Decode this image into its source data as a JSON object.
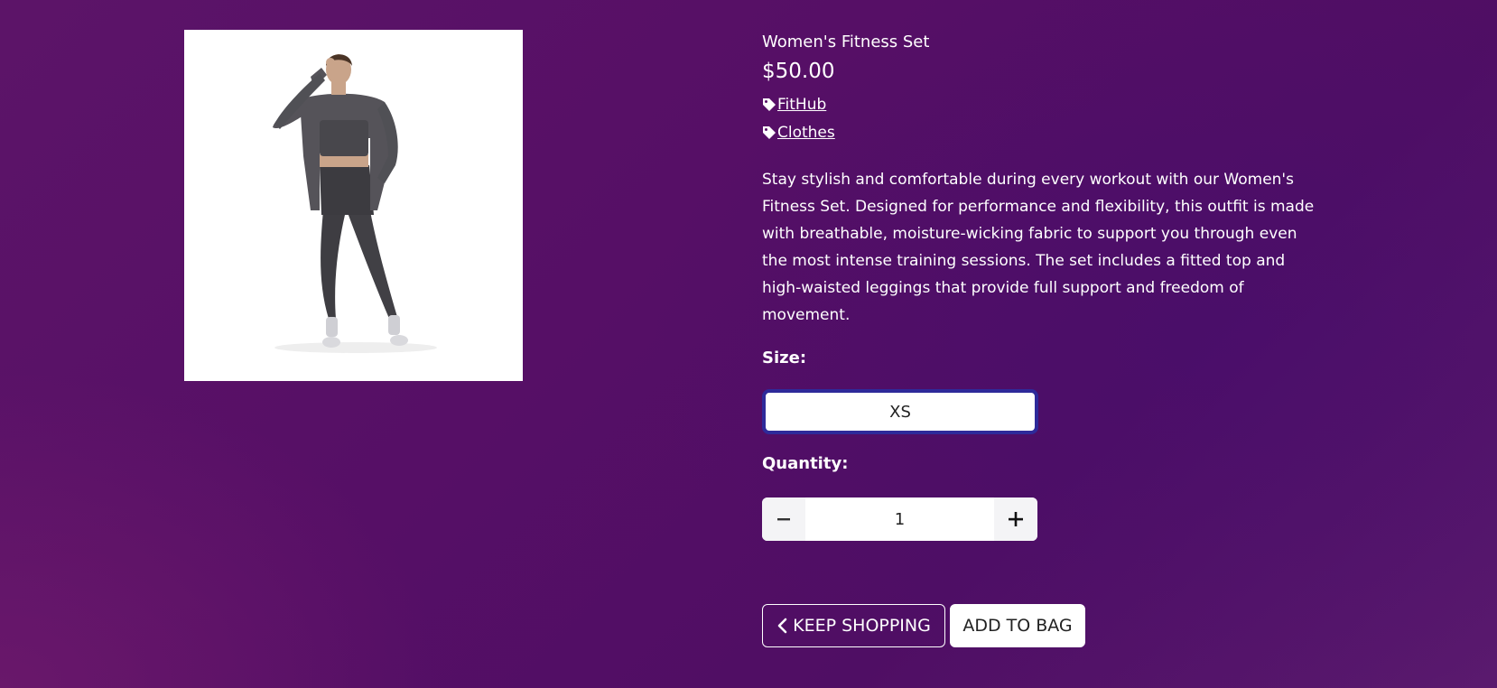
{
  "product": {
    "title": "Women's Fitness Set",
    "price": "$50.00",
    "brand": "FitHub",
    "category": "Clothes",
    "description": "Stay stylish and comfortable during every workout with our Women's Fitness Set. Designed for performance and flexibility, this outfit is made with breathable, moisture-wicking fabric to support you through even the most intense training sessions. The set includes a fitted top and high-waisted leggings that provide full support and freedom of movement."
  },
  "size": {
    "label": "Size:",
    "selected": "XS"
  },
  "quantity": {
    "label": "Quantity:",
    "value": "1"
  },
  "actions": {
    "keep_shopping": "KEEP SHOPPING",
    "add_to_bag": "ADD TO BAG"
  },
  "icons": {
    "tag": "tag-icon",
    "minus": "minus-icon",
    "plus": "plus-icon",
    "back": "chevron-left-icon"
  },
  "colors": {
    "background": "#560f66",
    "select_border": "#2e2a9a"
  }
}
